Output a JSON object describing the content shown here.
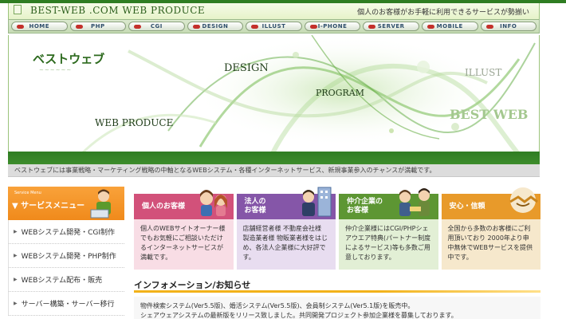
{
  "header": {
    "site_name": "BEST-WEB .COM WEB PRODUCE",
    "tagline": "個人のお客様がお手軽に利用できるサービスが勢揃い"
  },
  "nav": {
    "items": [
      {
        "label": "HOME"
      },
      {
        "label": "PHP"
      },
      {
        "label": "CGI"
      },
      {
        "label": "DESIGN"
      },
      {
        "label": "ILLUST"
      },
      {
        "label": "I-PHONE"
      },
      {
        "label": "SERVER"
      },
      {
        "label": "MOBILE"
      },
      {
        "label": "INFO"
      }
    ]
  },
  "hero": {
    "logo": "ベストウェブ",
    "logo_sub": "~~~~~~",
    "words": {
      "design": "DESIGN",
      "program": "PROGRAM",
      "illust": "ILLUST",
      "web_produce": "WEB PRODUCE",
      "best_web": "BEST WEB"
    }
  },
  "notice": "ベストウェブには事業戦略・マーケティング戦略の中軸となるWEBシステム・各種インターネットサービス、新規事業参入のチャンスが満載です。",
  "sidebar": {
    "head_small": "Service Menu",
    "head_title": "▼ サービスメニュー",
    "items": [
      {
        "label": "WEBシステム開発・CGI制作"
      },
      {
        "label": "WEBシステム開発・PHP制作"
      },
      {
        "label": "WEBシステム配布・販売"
      },
      {
        "label": "サーバー構築・サーバー移行"
      }
    ]
  },
  "cards": [
    {
      "title": "個人のお客様",
      "body": "個人のWEBサイトオーナー様でもお気軽にご相談いただけるインターネットサービスが満載です。"
    },
    {
      "title": "法人の\nお客様",
      "body": "店舗経営者様 不動産会社様 製造業者様 物販業者様をはじめ、各法人企業様に大好評です。"
    },
    {
      "title": "仲介企業の\nお客様",
      "body": "仲介企業様にはCGI/PHPシェアウエア特典(パートナー制度によるサービス)等も多数ご用意しております。"
    },
    {
      "title": "安心・信頼",
      "body": "全国から多数のお客様にご利用頂いており 2000年より申中無休でWEBサービスを提供中です。"
    }
  ],
  "info": {
    "title": "インフォメーション/お知らせ",
    "line1": "物件検索システム(Ver5.5版)、婚活システム(Ver5.5版)、会員制システム(Ver5.1版)を販売中。",
    "line2": "シェアウェアシステムの最新版をリリース致しました。共同開発プロジェクト参加企業様を募集しております。"
  },
  "colors": {
    "brand_green": "#2f7d22",
    "sidebar_orange": "#f08a1b",
    "card_pink": "#d2517a",
    "card_purple": "#8556a8",
    "card_green": "#5d9633",
    "card_orange": "#e89a2a",
    "info_underline": "#f2b21a"
  }
}
